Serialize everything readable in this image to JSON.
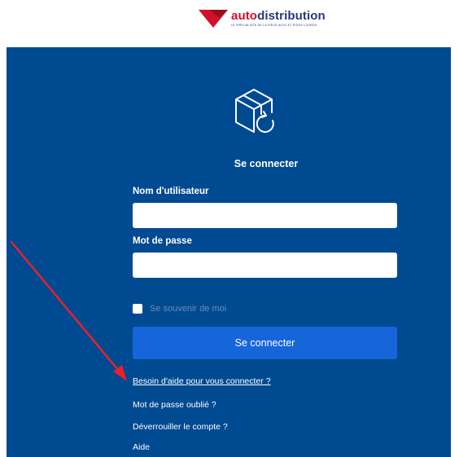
{
  "colors": {
    "panel": "#004a91",
    "button": "#1666d9",
    "brand_red": "#d0112b",
    "brand_blue": "#243b7a",
    "annotation_arrow": "#e8212b"
  },
  "header": {
    "logo_part1": "auto",
    "logo_part2": "distribution",
    "logo_tagline": "LE SPÉCIALISTE DE LA PIÈCE AUTO ET POIDS LOURDS"
  },
  "login": {
    "icon": "box-return-icon",
    "title": "Se connecter",
    "username_label": "Nom d'utilisateur",
    "username_value": "",
    "password_label": "Mot de passe",
    "password_value": "",
    "remember_label": "Se souvenir de moi",
    "remember_checked": false,
    "submit_label": "Se connecter"
  },
  "help": {
    "need_help": "Besoin d'aide pour vous connecter ?",
    "forgot_password": "Mot de passe oublié ?",
    "unlock_account": "Déverrouiller le compte ?",
    "help": "Aide"
  },
  "annotation": {
    "icon": "red-arrow-icon"
  }
}
